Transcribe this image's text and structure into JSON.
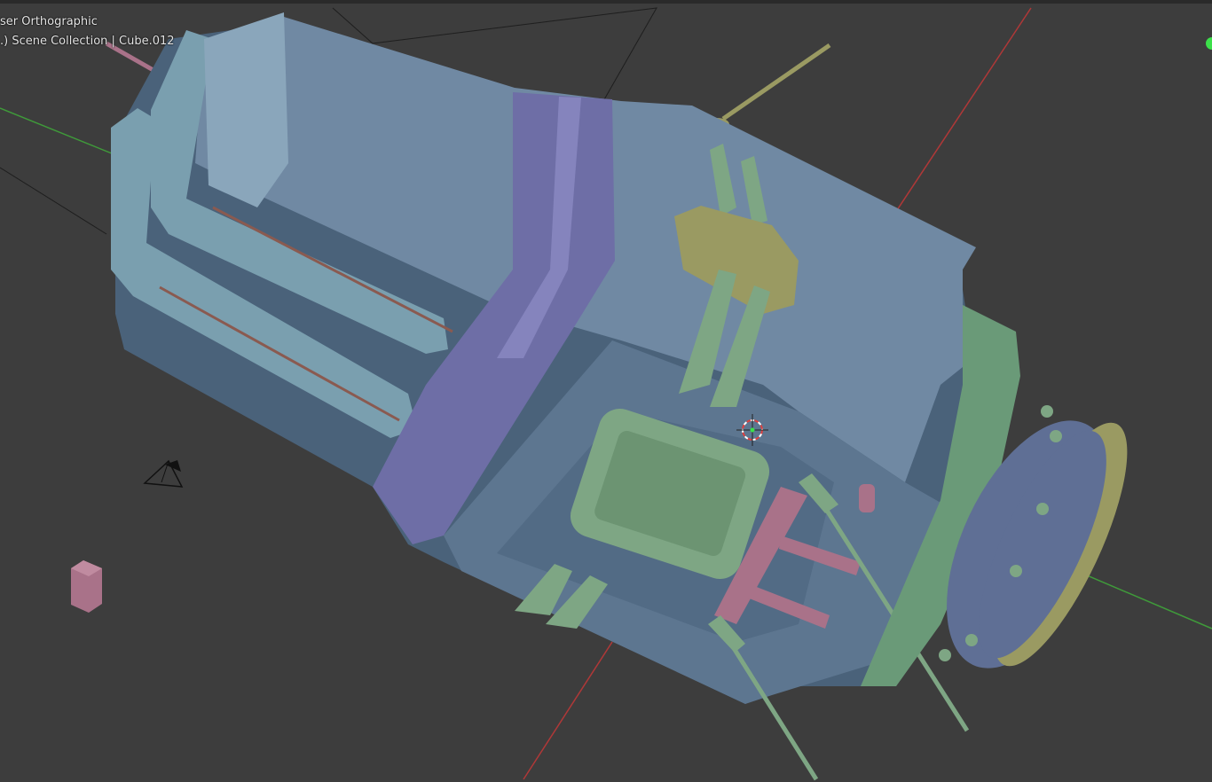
{
  "viewport": {
    "view_title": "ser Orthographic",
    "scene_info": ".) Scene Collection | Cube.012"
  },
  "colors": {
    "background": "#3d3d3d",
    "hull_top": "#7089a3",
    "hull_side": "#506a83",
    "hull_dark": "#3f5670",
    "band_purple": "#6e6ea6",
    "teal_parts": "#7a9faf",
    "green_parts": "#7ea684",
    "yellow_parts": "#9a9a62",
    "pink_parts": "#a97289",
    "x_axis": "#b03838",
    "y_axis": "#3f9a3a"
  },
  "icons": [
    "3d-cursor-icon",
    "camera-icon",
    "gizmo-dot-icon"
  ]
}
